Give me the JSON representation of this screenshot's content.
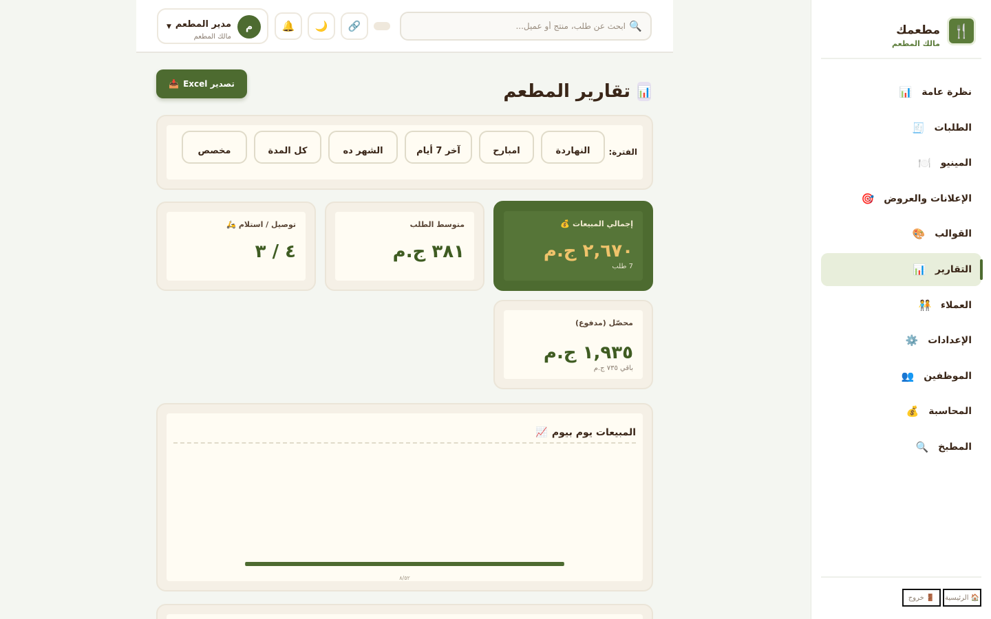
{
  "sidebar": {
    "brand_name": "مطعمك",
    "brand_sub": "مالك المطعم",
    "items": [
      {
        "label": "نظرة عامة",
        "icon": "📊",
        "active": false
      },
      {
        "label": "الطلبات",
        "icon": "🧾",
        "active": false
      },
      {
        "label": "المينيو",
        "icon": "🍽️",
        "active": false
      },
      {
        "label": "الإعلانات والعروض",
        "icon": "🎯",
        "active": false
      },
      {
        "label": "القوالب",
        "icon": "🎨",
        "active": false
      },
      {
        "label": "التقارير",
        "icon": "📊",
        "active": true
      },
      {
        "label": "العملاء",
        "icon": "🧑‍🤝‍🧑",
        "active": false
      },
      {
        "label": "الإعدادات",
        "icon": "⚙️",
        "active": false
      },
      {
        "label": "الموظفين",
        "icon": "👥",
        "active": false
      },
      {
        "label": "المحاسبة",
        "icon": "💰",
        "active": false
      },
      {
        "label": "المطبخ",
        "icon": "🔍",
        "active": false
      }
    ],
    "footer": {
      "home_label": "الرئيسية",
      "logout_label": "خروج"
    }
  },
  "topbar": {
    "search_placeholder": "ابحث عن طلب، منتج أو عميل...",
    "user_name": "مدير المطعم",
    "user_role": "مالك المطعم",
    "avatar_initial": "م"
  },
  "page": {
    "title": "تقارير المطعم",
    "export_label": "تصدير Excel"
  },
  "period": {
    "label": "الفترة:",
    "options": [
      "النهاردة",
      "امبارح",
      "آخر 7 أيام",
      "الشهر ده",
      "كل المدة",
      "مخصص"
    ]
  },
  "stats": {
    "total": {
      "label": "إجمالي المبيعات",
      "value": "٢,٦٧٠ ج.م",
      "sub": "7 طلب"
    },
    "avg": {
      "label": "متوسط الطلب",
      "value": "٣٨١ ج.م"
    },
    "delivery": {
      "label": "توصيل / استلام",
      "value": "٤ / ٣"
    },
    "collected": {
      "label": "محصّل (مدفوع)",
      "value": "١,٩٣٥ ج.م",
      "sub": "باقي ٧٣٥ ج.م"
    }
  },
  "chart_data": {
    "type": "bar",
    "title": "المبيعات يوم بيوم",
    "categories": [
      "٨/٥٢"
    ],
    "values": [
      2670
    ]
  },
  "colors": {
    "primary": "#4d6b30",
    "accent_gold": "#f0c36b",
    "text": "#3a2618",
    "card_bg": "#f5f0e6"
  }
}
